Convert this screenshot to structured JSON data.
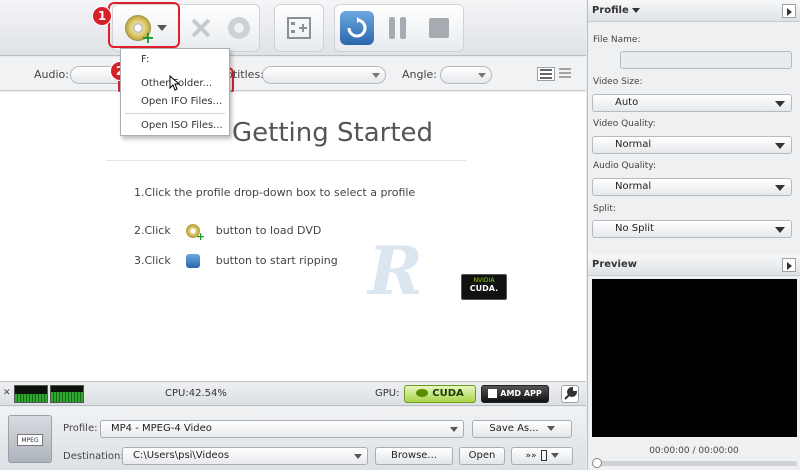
{
  "toolbar": {
    "badge1": "1",
    "badge2": "2"
  },
  "dropdown": {
    "items": [
      "F:",
      "Other Folder...",
      "Open IFO Files...",
      "Open ISO Files..."
    ]
  },
  "options": {
    "audio_label": "Audio:",
    "subtitles_label": "Subtitles:",
    "angle_label": "Angle:"
  },
  "main": {
    "title": "Getting Started",
    "step1": "1.Click the profile drop-down box to select a profile",
    "step2_a": "2.Click",
    "step2_b": "button to load DVD",
    "step3_a": "3.Click",
    "step3_b": "button to start ripping",
    "nvidia_top": "NVIDIA",
    "nvidia_bottom": "CUDA."
  },
  "status": {
    "cpu": "CPU:42.54%",
    "gpu_label": "GPU:",
    "cuda": "CUDA",
    "amd": "AMD APP"
  },
  "bottom": {
    "profile_label": "Profile:",
    "profile_value": "MP4 - MPEG-4 Video",
    "save_as": "Save As...",
    "destination_label": "Destination:",
    "destination_value": "C:\\Users\\psi\\Videos",
    "browse": "Browse...",
    "open": "Open",
    "film_label": "MPEG"
  },
  "right": {
    "profile_header": "Profile",
    "file_name_label": "File Name:",
    "video_size_label": "Video Size:",
    "video_size_value": "Auto",
    "video_quality_label": "Video Quality:",
    "video_quality_value": "Normal",
    "audio_quality_label": "Audio Quality:",
    "audio_quality_value": "Normal",
    "split_label": "Split:",
    "split_value": "No Split",
    "preview_header": "Preview",
    "time": "00:00:00 / 00:00:00"
  },
  "colors": {
    "highlight": "#e0202a",
    "cuda_green": "#a9d44a"
  }
}
